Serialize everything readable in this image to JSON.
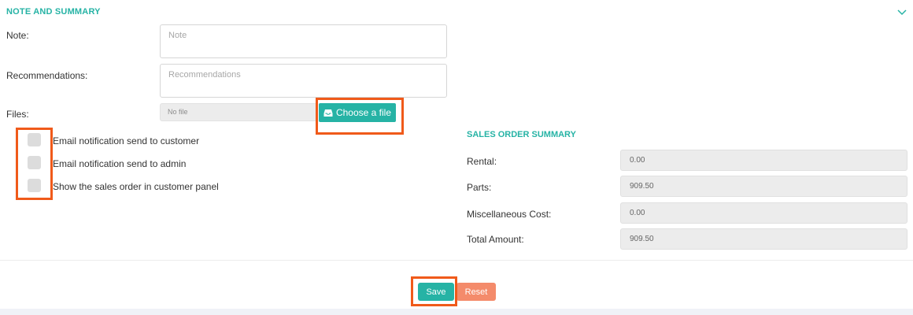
{
  "section": {
    "title": "NOTE AND SUMMARY",
    "collapse_icon": "chevron-down-icon"
  },
  "note": {
    "label": "Note:",
    "placeholder": "Note",
    "value": ""
  },
  "recommendations": {
    "label": "Recommendations:",
    "placeholder": "Recommendations",
    "value": ""
  },
  "files": {
    "label": "Files:",
    "status": "No file",
    "button_label": "Choose a file",
    "button_icon": "inbox-tray-icon"
  },
  "checkboxes": [
    {
      "label": "Email notification send to customer",
      "checked": false
    },
    {
      "label": "Email notification send to admin",
      "checked": false
    },
    {
      "label": "Show the sales order in customer panel",
      "checked": false
    }
  ],
  "summary": {
    "title": "SALES ORDER SUMMARY",
    "rows": [
      {
        "label": "Rental:",
        "value": "0.00"
      },
      {
        "label": "Parts:",
        "value": "909.50"
      },
      {
        "label": "Miscellaneous Cost:",
        "value": "0.00"
      },
      {
        "label": "Total Amount:",
        "value": "909.50"
      }
    ]
  },
  "actions": {
    "save_label": "Save",
    "reset_label": "Reset"
  },
  "colors": {
    "accent": "#26b3a5",
    "reset": "#f48b6b",
    "highlight": "#f05a1a",
    "field_bg": "#ececec"
  }
}
